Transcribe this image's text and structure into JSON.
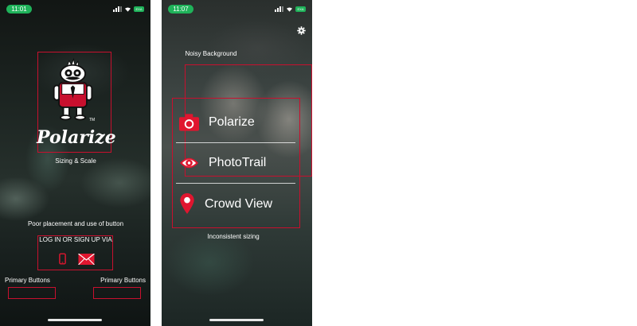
{
  "phone1": {
    "status": {
      "time": "11:01",
      "battery": "EXA"
    },
    "logo": {
      "brand_text": "Polarize",
      "trademark": "TM"
    },
    "annotations": {
      "sizing": "Sizing & Scale",
      "placement": "Poor placement and use of button",
      "primary_left": "Primary Buttons",
      "primary_right": "Primary Buttons"
    },
    "login": {
      "prompt": "LOG IN OR SIGN UP VIA"
    },
    "colors": {
      "accent": "#c8102e",
      "clock": "#1fb35a"
    }
  },
  "phone2": {
    "status": {
      "time": "11:07",
      "battery": "EXA"
    },
    "annotations": {
      "noisy": "Noisy Background",
      "inconsistent": "Inconsistent sizing"
    },
    "menu": [
      {
        "label": "Polarize",
        "icon": "camera-icon"
      },
      {
        "label": "PhotoTrail",
        "icon": "eye-icon"
      },
      {
        "label": "Crowd View",
        "icon": "location-pin-icon"
      }
    ]
  }
}
